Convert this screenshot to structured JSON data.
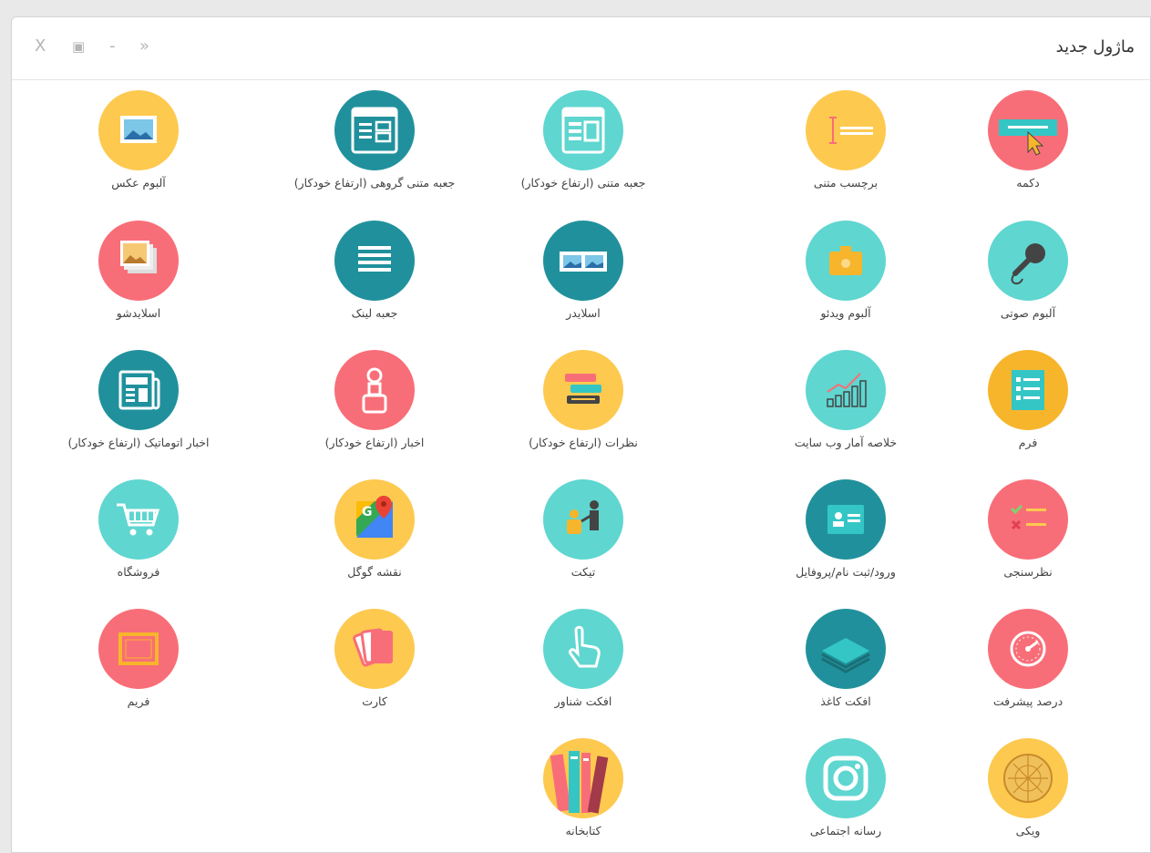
{
  "dialog": {
    "title": "ماژول جدید"
  },
  "controls": {
    "close": "X",
    "maximize": "▣",
    "minimize": "-",
    "collapse": "»"
  },
  "colors": {
    "teal": "#5fd6d0",
    "dark_teal": "#20919c",
    "coral": "#f86e78",
    "yellow": "#fdc94f",
    "orange": "#f7b52c"
  },
  "modules": [
    {
      "label": "دکمه",
      "icon": "button-click-icon",
      "color": "#f86e78"
    },
    {
      "label": "برچسب متنی",
      "icon": "text-label-icon",
      "color": "#fdc94f"
    },
    {
      "label": "جعبه متنی (ارتفاع خودکار)",
      "icon": "text-box-icon",
      "color": "#5fd6d0"
    },
    {
      "label": "جعبه متنی گروهی (ارتفاع خودکار)",
      "icon": "group-text-box-icon",
      "color": "#20919c"
    },
    {
      "label": "آلبوم عکس",
      "icon": "photo-album-icon",
      "color": "#fdc94f"
    },
    {
      "label": "آلبوم صوتی",
      "icon": "microphone-icon",
      "color": "#5fd6d0"
    },
    {
      "label": "آلبوم ویدئو",
      "icon": "video-album-icon",
      "color": "#5fd6d0"
    },
    {
      "label": "اسلایدر",
      "icon": "slider-icon",
      "color": "#20919c"
    },
    {
      "label": "جعبه لینک",
      "icon": "link-list-icon",
      "color": "#20919c"
    },
    {
      "label": "اسلایدشو",
      "icon": "slideshow-icon",
      "color": "#f86e78"
    },
    {
      "label": "فرم",
      "icon": "form-icon",
      "color": "#f7b52c"
    },
    {
      "label": "خلاصه آمار وب سایت",
      "icon": "stats-chart-icon",
      "color": "#5fd6d0"
    },
    {
      "label": "نظرات (ارتفاع خودکار)",
      "icon": "comments-icon",
      "color": "#fdc94f"
    },
    {
      "label": "اخبار (ارتفاع خودکار)",
      "icon": "news-reader-icon",
      "color": "#f86e78"
    },
    {
      "label": "اخبار اتوماتیک (ارتفاع خودکار)",
      "icon": "newspaper-icon",
      "color": "#20919c"
    },
    {
      "label": "نظرسنجی",
      "icon": "poll-icon",
      "color": "#f86e78"
    },
    {
      "label": "ورود/ثبت نام/پروفایل",
      "icon": "profile-card-icon",
      "color": "#20919c"
    },
    {
      "label": "تیکت",
      "icon": "ticket-support-icon",
      "color": "#5fd6d0"
    },
    {
      "label": "نقشه گوگل",
      "icon": "google-maps-icon",
      "color": "#fdc94f"
    },
    {
      "label": "فروشگاه",
      "icon": "shopping-cart-icon",
      "color": "#5fd6d0"
    },
    {
      "label": "درصد پیشرفت",
      "icon": "progress-gauge-icon",
      "color": "#f86e78"
    },
    {
      "label": "افکت کاغذ",
      "icon": "paper-stack-icon",
      "color": "#20919c"
    },
    {
      "label": "افکت شناور",
      "icon": "hand-pointer-icon",
      "color": "#5fd6d0"
    },
    {
      "label": "کارت",
      "icon": "cards-icon",
      "color": "#fdc94f"
    },
    {
      "label": "فریم",
      "icon": "frame-icon",
      "color": "#f86e78"
    },
    {
      "label": "ویکی",
      "icon": "wiki-globe-icon",
      "color": "#fdc94f"
    },
    {
      "label": "رسانه اجتماعی",
      "icon": "instagram-icon",
      "color": "#5fd6d0"
    },
    {
      "label": "کتابخانه",
      "icon": "books-icon",
      "color": "#fdc94f"
    }
  ]
}
